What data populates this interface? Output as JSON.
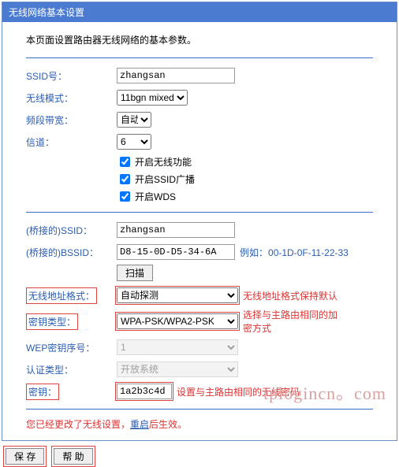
{
  "panel": {
    "title": "无线网络基本设置",
    "description": "本页面设置路由器无线网络的基本参数。"
  },
  "fields": {
    "ssid": {
      "label": "SSID号：",
      "value": "zhangsan"
    },
    "mode": {
      "label": "无线模式：",
      "value": "11bgn mixed"
    },
    "bandwidth": {
      "label": "频段带宽：",
      "value": "自动"
    },
    "channel": {
      "label": "信道：",
      "value": "6"
    }
  },
  "checks": {
    "enable_wifi": {
      "label": "开启无线功能",
      "checked": true
    },
    "enable_ssid_bcast": {
      "label": "开启SSID广播",
      "checked": true
    },
    "enable_wds": {
      "label": "开启WDS",
      "checked": true
    }
  },
  "bridge": {
    "ssid": {
      "label": "(桥接的)SSID：",
      "value": "zhangsan"
    },
    "bssid": {
      "label": "(桥接的)BSSID：",
      "value": "D8-15-0D-D5-34-6A",
      "example_prefix": "例如：",
      "example": "00-1D-0F-11-22-33"
    },
    "scan": "扫描",
    "addr_format": {
      "label": "无线地址格式：",
      "value": "自动探测",
      "hint": "无线地址格式保持默认"
    },
    "key_type": {
      "label": "密钥类型：",
      "value": "WPA-PSK/WPA2-PSK",
      "hint": "选择与主路由相同的加密方式"
    },
    "wep_index": {
      "label": "WEP密钥序号：",
      "value": "1"
    },
    "auth_type": {
      "label": "认证类型：",
      "value": "开放系统"
    },
    "key": {
      "label": "密钥：",
      "value": "1a2b3c4d",
      "hint": "设置与主路由相同的无线密码"
    }
  },
  "changed_notice": {
    "pre": "您已经更改了无线设置，",
    "link": "重启",
    "post": "后生效。"
  },
  "buttons": {
    "save": "保 存",
    "help": "帮 助"
  },
  "watermark": "tplogincn。com"
}
